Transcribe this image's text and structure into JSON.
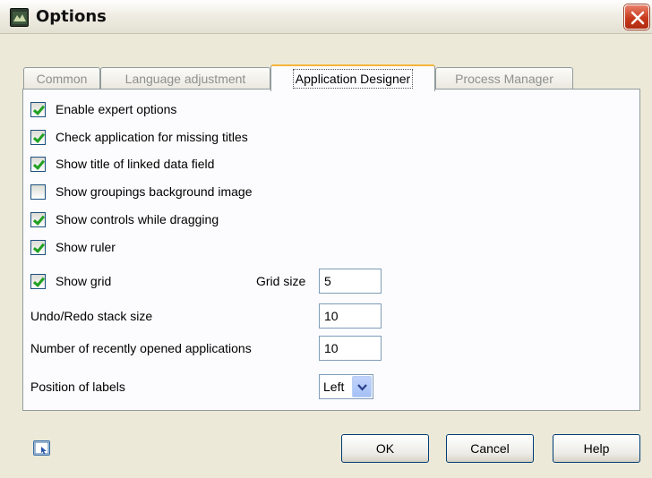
{
  "window": {
    "title": "Options",
    "icon": "app-icon",
    "close_icon": "close-icon"
  },
  "tabs": [
    {
      "label": "Common",
      "active": false
    },
    {
      "label": "Language adjustment",
      "active": false
    },
    {
      "label": "Application Designer",
      "active": true
    },
    {
      "label": "Process Manager",
      "active": false
    }
  ],
  "options": {
    "enable_expert": {
      "label": "Enable expert options",
      "checked": true
    },
    "check_missing_titles": {
      "label": "Check application for missing titles",
      "checked": true
    },
    "show_title_linked": {
      "label": "Show title of linked data field",
      "checked": true
    },
    "show_groupings_bg": {
      "label": "Show groupings background image",
      "checked": false
    },
    "show_controls_dragging": {
      "label": "Show controls while dragging",
      "checked": true
    },
    "show_ruler": {
      "label": "Show ruler",
      "checked": true
    },
    "show_grid": {
      "label": "Show grid",
      "checked": true
    }
  },
  "fields": {
    "grid_size": {
      "label": "Grid size",
      "value": "5"
    },
    "undo_redo": {
      "label": "Undo/Redo stack size",
      "value": "10"
    },
    "recent_apps": {
      "label": "Number of recently opened applications",
      "value": "10"
    },
    "label_position": {
      "label": "Position of labels",
      "value": "Left"
    }
  },
  "buttons": {
    "ok": "OK",
    "cancel": "Cancel",
    "help": "Help"
  },
  "colors": {
    "dialog_bg": "#ece9d8",
    "panel_bg": "#fcfcfe",
    "close_red": "#c8391c",
    "active_tab_accent": "#f5b53a",
    "check_green": "#21a121"
  }
}
